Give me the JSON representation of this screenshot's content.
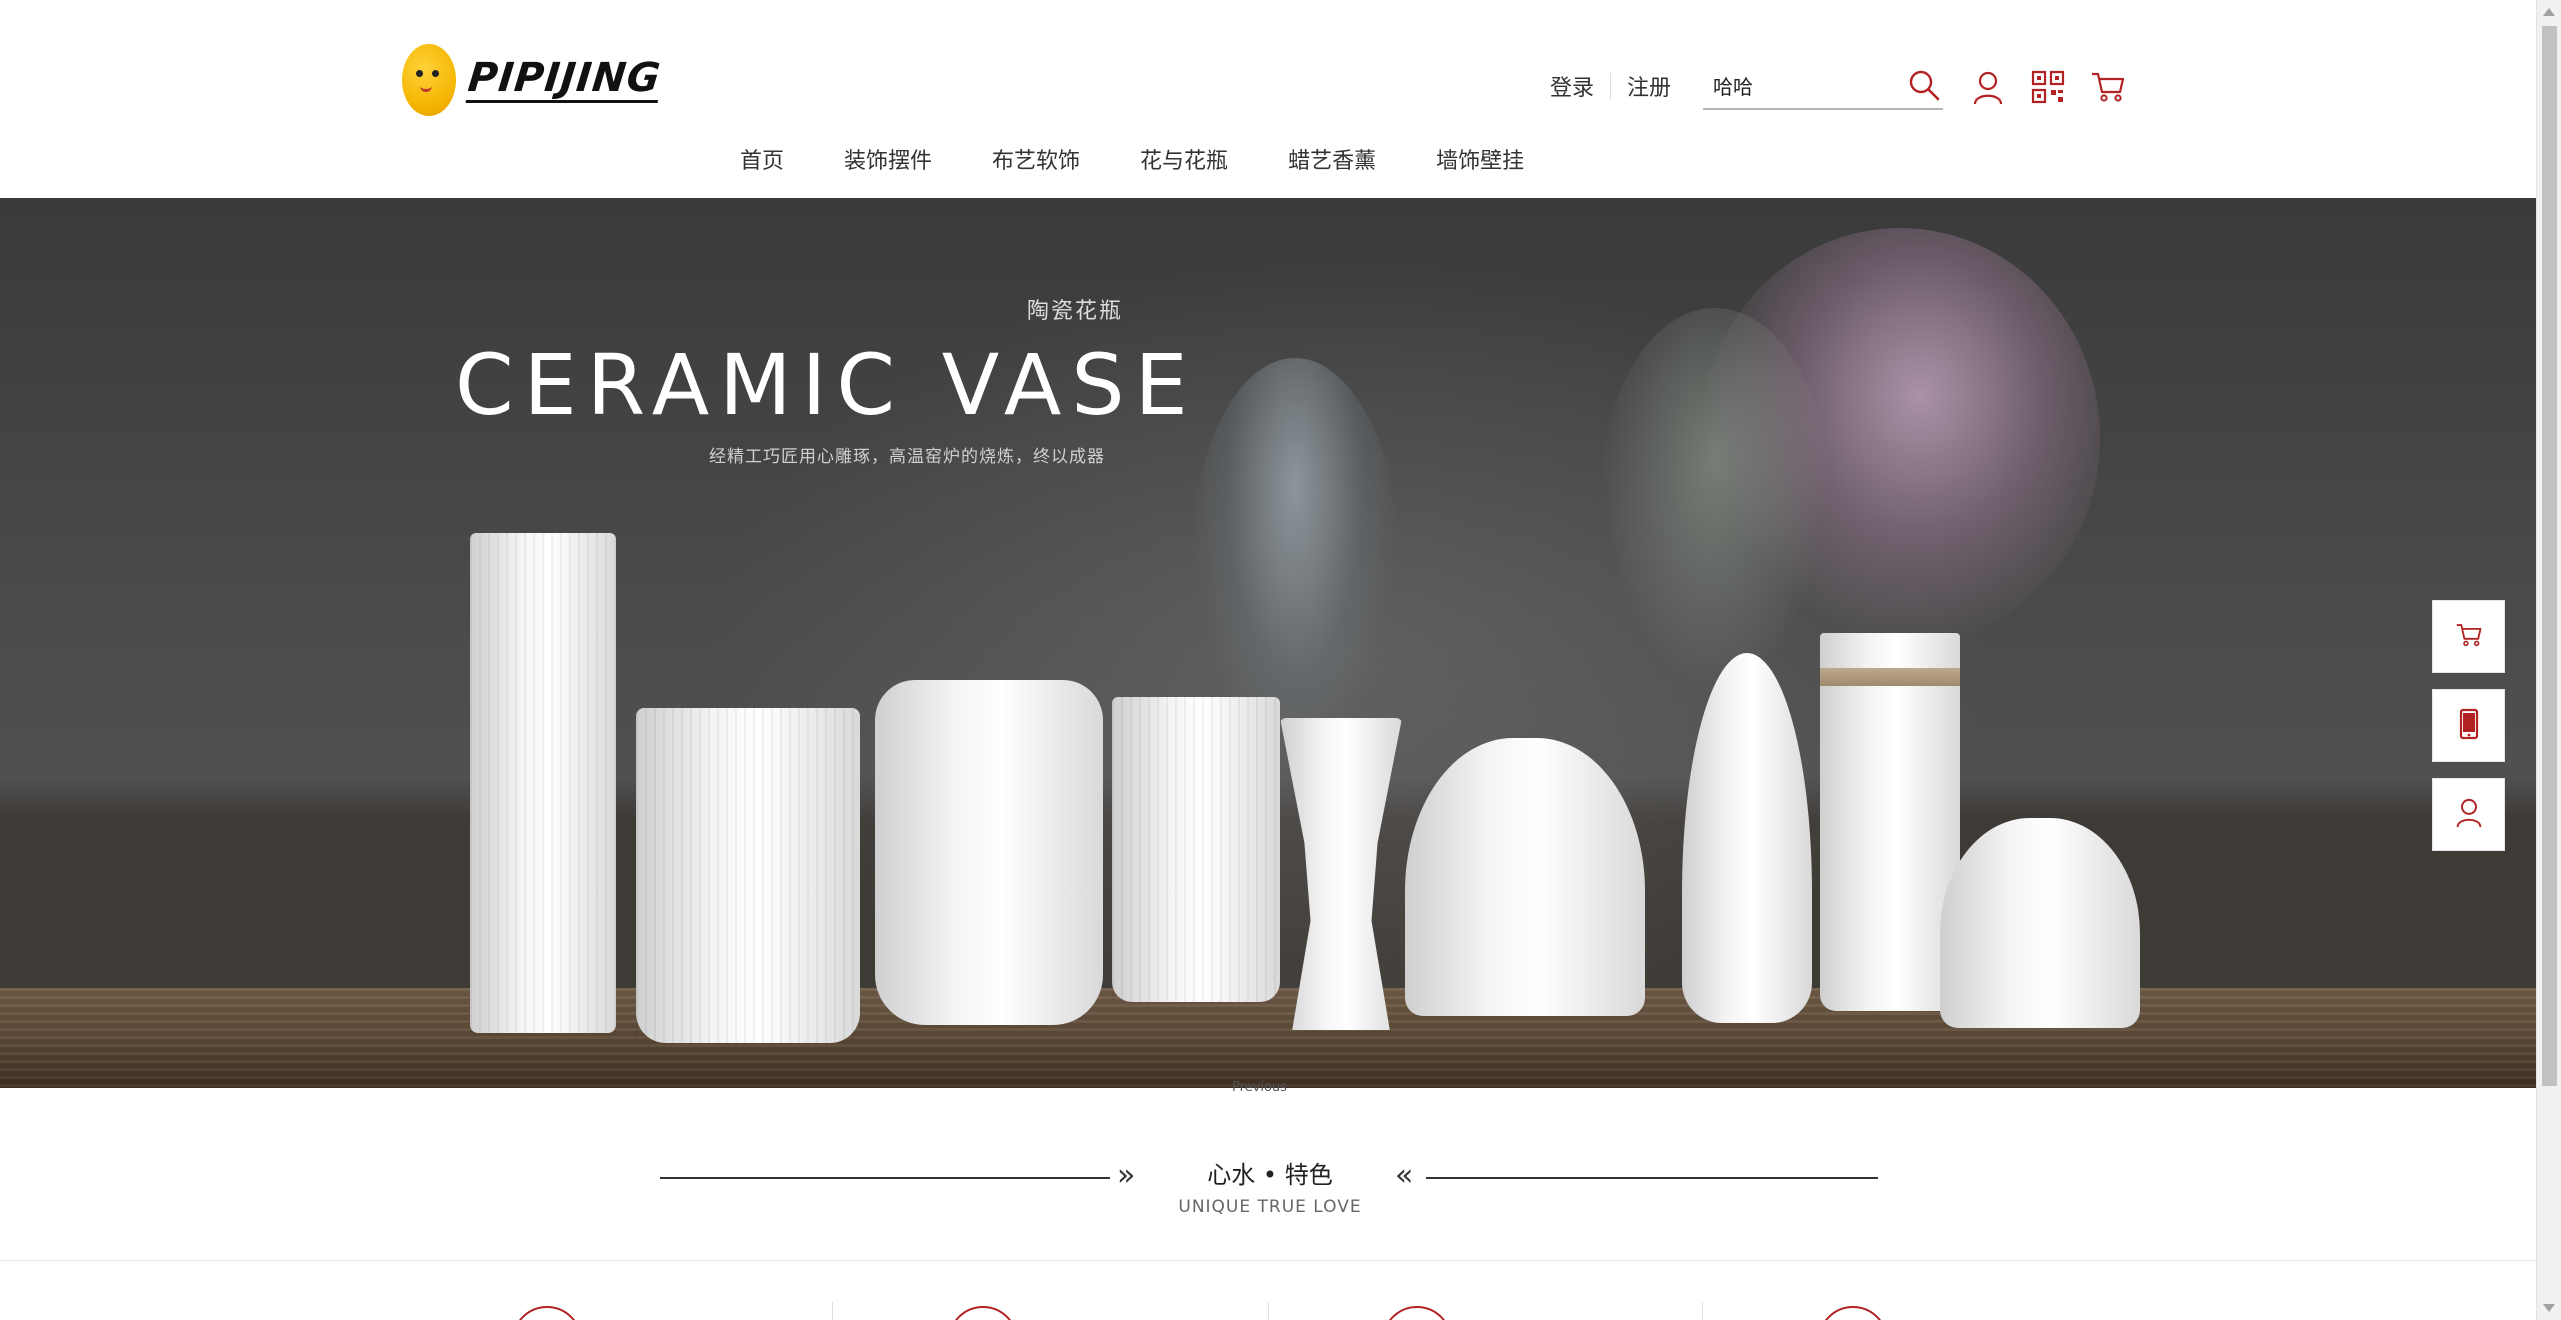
{
  "logo": {
    "text": "PIPIJING",
    "icon": "smiley-face-logo"
  },
  "header": {
    "login_label": "登录",
    "register_label": "注册",
    "search": {
      "value": "哈哈",
      "icon": "search-icon"
    },
    "icons": [
      "user-icon",
      "qrcode-icon",
      "cart-icon"
    ],
    "accent_color": "#b22222"
  },
  "nav": {
    "items": [
      {
        "label": "首页"
      },
      {
        "label": "装饰摆件"
      },
      {
        "label": "布艺软饰"
      },
      {
        "label": "花与花瓶"
      },
      {
        "label": "蜡艺香薰"
      },
      {
        "label": "墙饰壁挂"
      }
    ]
  },
  "banner": {
    "kicker": "陶瓷花瓶",
    "headline": "CERAMIC VASE",
    "subline": "经精工巧匠用心雕琢，高温窑炉的烧炼，终以成器",
    "caption": "Previous"
  },
  "float_bar": {
    "icons": [
      "cart-icon",
      "mobile-icon",
      "user-icon"
    ]
  },
  "section": {
    "cn_title": "心水 • 特色",
    "en_title": "UNIQUE TRUE LOVE",
    "left_arrow": "»",
    "right_arrow": "«"
  }
}
